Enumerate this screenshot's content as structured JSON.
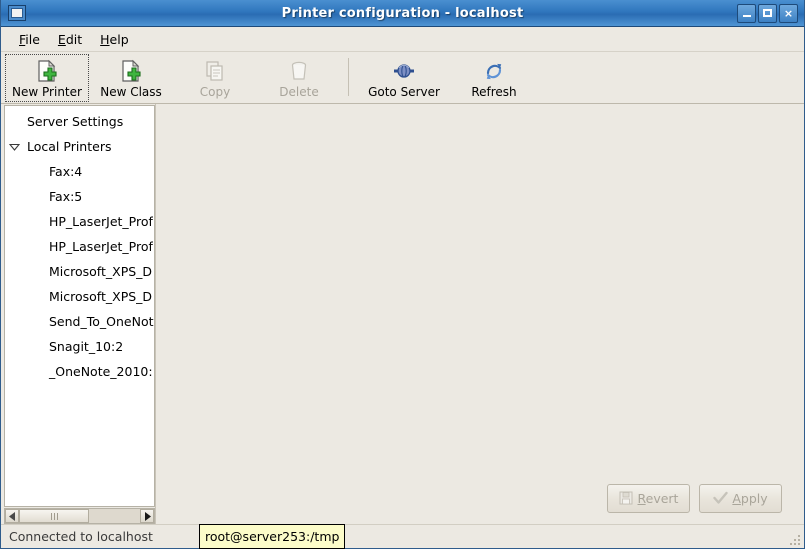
{
  "window": {
    "title": "Printer configuration - localhost",
    "icon": "window-icon",
    "buttons": {
      "minimize": "minimize-icon",
      "maximize": "maximize-icon",
      "close": "×"
    }
  },
  "menubar": {
    "items": [
      {
        "label": "File",
        "mnemonic": "F",
        "rest": "ile"
      },
      {
        "label": "Edit",
        "mnemonic": "E",
        "rest": "dit"
      },
      {
        "label": "Help",
        "mnemonic": "H",
        "rest": "elp"
      }
    ]
  },
  "toolbar": {
    "buttons": [
      {
        "label": "New Printer",
        "icon": "new-printer-icon",
        "enabled": true,
        "focused": true
      },
      {
        "label": "New Class",
        "icon": "new-class-icon",
        "enabled": true,
        "focused": false
      },
      {
        "label": "Copy",
        "icon": "copy-icon",
        "enabled": false,
        "focused": false
      },
      {
        "label": "Delete",
        "icon": "delete-icon",
        "enabled": false,
        "focused": false
      },
      {
        "label": "Goto Server",
        "icon": "goto-server-icon",
        "enabled": true,
        "focused": false
      },
      {
        "label": "Refresh",
        "icon": "refresh-icon",
        "enabled": true,
        "focused": false
      }
    ]
  },
  "sidebar": {
    "tree": [
      {
        "label": "Server Settings",
        "level": 0,
        "expander": false
      },
      {
        "label": "Local Printers",
        "level": 0,
        "expander": true,
        "expanded": true
      },
      {
        "label": "Fax:4",
        "level": 1,
        "expander": false
      },
      {
        "label": "Fax:5",
        "level": 1,
        "expander": false
      },
      {
        "label": "HP_LaserJet_Prof",
        "level": 1,
        "expander": false
      },
      {
        "label": "HP_LaserJet_Prof",
        "level": 1,
        "expander": false
      },
      {
        "label": "Microsoft_XPS_D",
        "level": 1,
        "expander": false
      },
      {
        "label": "Microsoft_XPS_D",
        "level": 1,
        "expander": false
      },
      {
        "label": "Send_To_OneNot",
        "level": 1,
        "expander": false
      },
      {
        "label": "Snagit_10:2",
        "level": 1,
        "expander": false
      },
      {
        "label": "_OneNote_2010:",
        "level": 1,
        "expander": false
      }
    ],
    "scrollbar": {
      "left_arrow": "scroll-left-icon",
      "right_arrow": "scroll-right-icon"
    }
  },
  "actions": {
    "revert": {
      "label": "Revert",
      "mnemonic": "R",
      "pre": "",
      "rest": "evert",
      "enabled": false,
      "icon": "revert-icon"
    },
    "apply": {
      "label": "Apply",
      "mnemonic": "A",
      "pre": "",
      "rest": "pply",
      "enabled": false,
      "icon": "apply-check-icon"
    }
  },
  "statusbar": {
    "text": "Connected to localhost",
    "tooltip": "root@server253:/tmp"
  },
  "colors": {
    "titlebar_blue": "#2f76bd",
    "window_bg": "#ece9e2",
    "list_bg": "#ffffff",
    "tooltip_bg": "#fcfcc9",
    "disabled_text": "#a9a59a"
  }
}
